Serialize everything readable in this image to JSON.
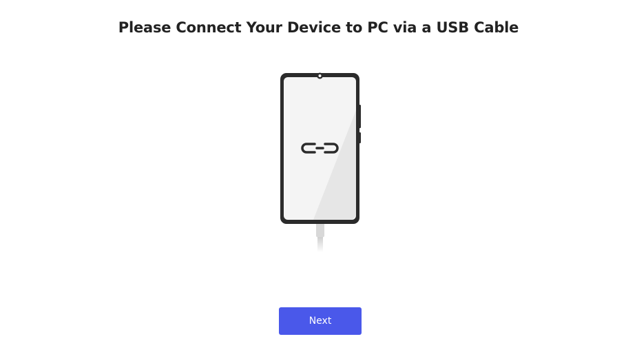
{
  "header": {
    "title": "Please Connect Your Device to PC via a USB Cable"
  },
  "illustration": {
    "device": "phone-icon",
    "screen_icon": "link-icon",
    "cable": "usb-cable-icon"
  },
  "actions": {
    "next_label": "Next"
  },
  "colors": {
    "accent": "#4a58ea",
    "title_text": "#222222",
    "phone_frame": "#2b2b2b",
    "screen": "#f2f2f2"
  }
}
